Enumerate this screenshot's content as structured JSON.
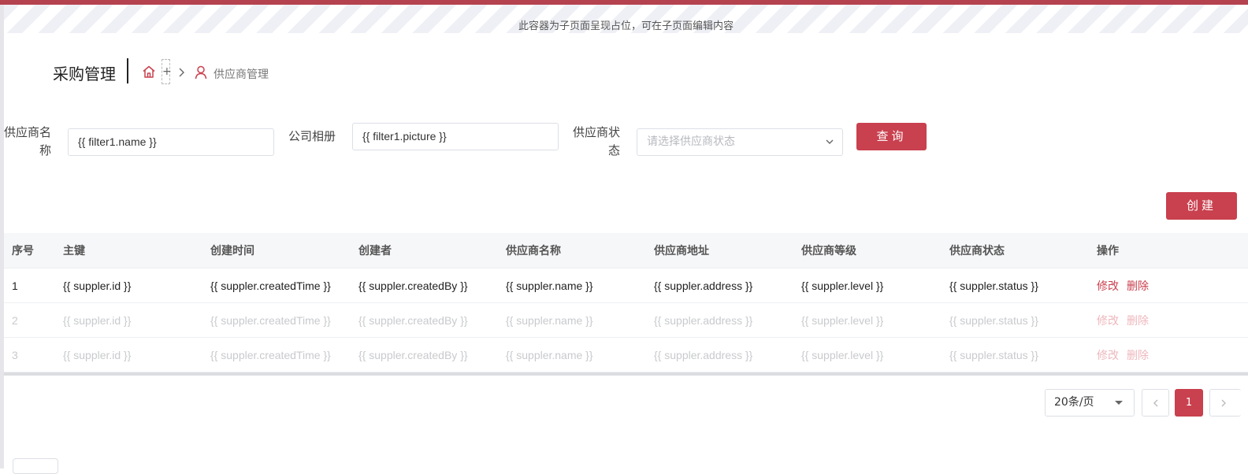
{
  "banner": {
    "text": "此容器为子页面呈现占位，可在子页面编辑内容"
  },
  "header": {
    "title": "采购管理",
    "breadcrumb": {
      "plus": "+",
      "current": "供应商管理"
    }
  },
  "filters": {
    "name_label_1": "供应商名",
    "name_label_2": "称",
    "name_value": "{{ filter1.name }}",
    "album_label": "公司相册",
    "album_value": "{{ filter1.picture }}",
    "status_label_1": "供应商状",
    "status_label_2": "态",
    "status_placeholder": "请选择供应商状态",
    "query_button": "查询"
  },
  "create_button": "创建",
  "table": {
    "columns": [
      "序号",
      "主键",
      "创建时间",
      "创建者",
      "供应商名称",
      "供应商地址",
      "供应商等级",
      "供应商状态",
      "操作"
    ],
    "rows": [
      {
        "index": "1",
        "id": "{{ suppler.id }}",
        "created_time": "{{ suppler.createdTime }}",
        "created_by": "{{ suppler.createdBy }}",
        "name": "{{ suppler.name }}",
        "address": "{{ suppler.address }}",
        "level": "{{ suppler.level }}",
        "status": "{{ suppler.status }}",
        "edit": "修改",
        "delete": "删除"
      },
      {
        "index": "2",
        "id": "{{ suppler.id }}",
        "created_time": "{{ suppler.createdTime }}",
        "created_by": "{{ suppler.createdBy }}",
        "name": "{{ suppler.name }}",
        "address": "{{ suppler.address }}",
        "level": "{{ suppler.level }}",
        "status": "{{ suppler.status }}",
        "edit": "修改",
        "delete": "删除"
      },
      {
        "index": "3",
        "id": "{{ suppler.id }}",
        "created_time": "{{ suppler.createdTime }}",
        "created_by": "{{ suppler.createdBy }}",
        "name": "{{ suppler.name }}",
        "address": "{{ suppler.address }}",
        "level": "{{ suppler.level }}",
        "status": "{{ suppler.status }}",
        "edit": "修改",
        "delete": "删除"
      }
    ]
  },
  "pagination": {
    "page_size": "20条/页",
    "current_page": "1"
  },
  "colors": {
    "accent": "#c9404e",
    "top_bar": "#b5424f",
    "header_bg": "#f6f7f9"
  },
  "icons": [
    "home-icon",
    "chevron-right-icon",
    "user-icon",
    "chevron-down-icon",
    "chevron-left-icon"
  ]
}
